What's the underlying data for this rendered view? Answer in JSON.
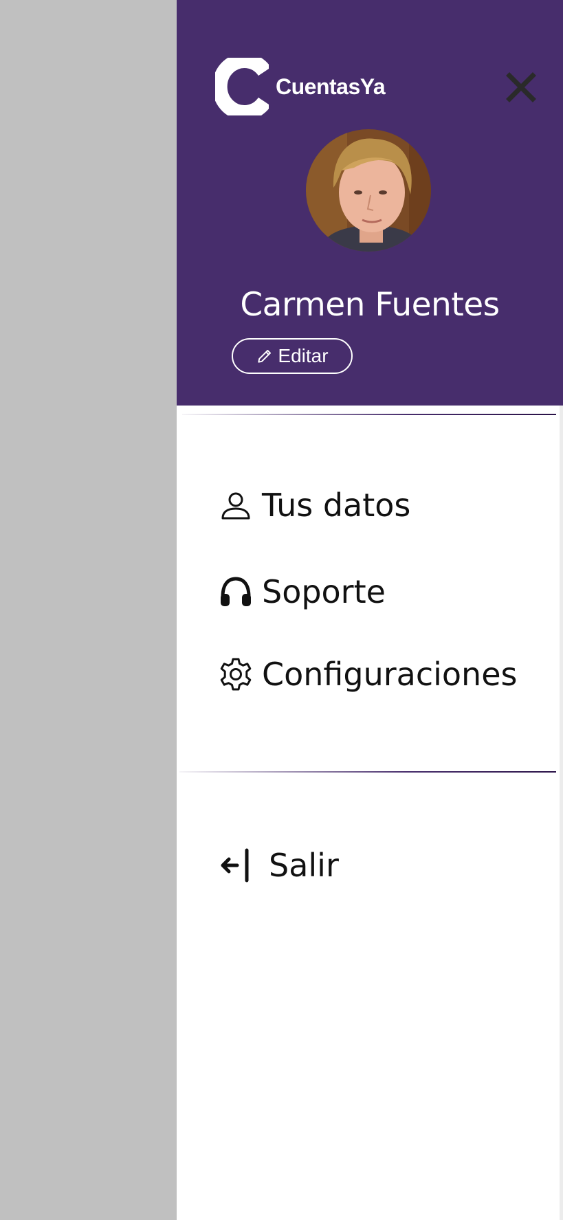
{
  "brand": {
    "name": "CuentasYa",
    "header_color": "#472d6c"
  },
  "user": {
    "name": "Carmen Fuentes",
    "edit_label": "Editar"
  },
  "menu": {
    "items": [
      {
        "label": "Tus datos",
        "icon": "user-icon"
      },
      {
        "label": "Soporte",
        "icon": "headphones-icon"
      },
      {
        "label": "Configuraciones",
        "icon": "gear-icon"
      }
    ],
    "logout": {
      "label": "Salir",
      "icon": "logout-arrow-icon"
    }
  }
}
